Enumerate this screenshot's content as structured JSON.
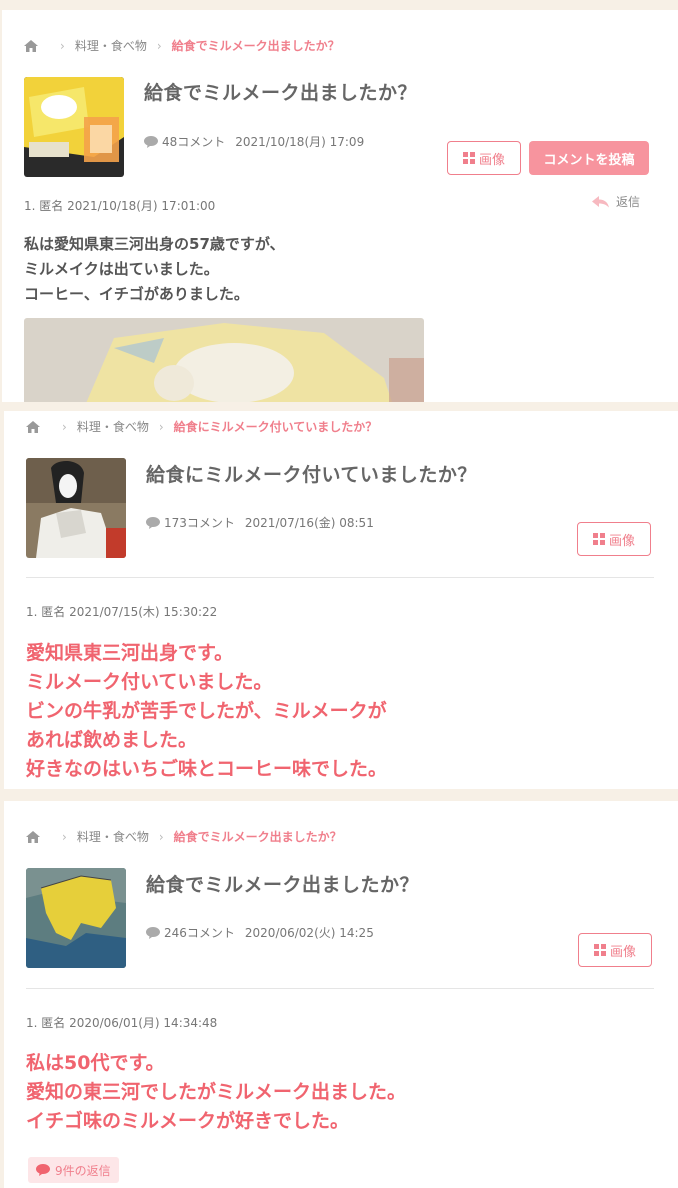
{
  "posts": [
    {
      "breadcrumb": {
        "category": "料理・食べ物",
        "current": "給食でミルメーク出ましたか？"
      },
      "title": "給食でミルメーク出ましたか？",
      "comment_count": "48コメント",
      "date": "2021/10/18(月) 17:09",
      "image_button": "画像",
      "post_button": "コメントを投稿",
      "comment_meta": "1. 匿名 2021/10/18(月) 17:01:00",
      "reply_label": "返信",
      "body": [
        "私は愛知県東三河出身の57歳ですが、",
        "ミルメイクは出ていました。",
        "コーヒー、イチゴがありました。"
      ]
    },
    {
      "breadcrumb": {
        "category": "料理・食べ物",
        "current": "給食にミルメーク付いていましたか？"
      },
      "title": "給食にミルメーク付いていましたか？",
      "comment_count": "173コメント",
      "date": "2021/07/16(金) 08:51",
      "image_button": "画像",
      "comment_meta": "1. 匿名 2021/07/15(木) 15:30:22",
      "body": [
        "愛知県東三河出身です。",
        "ミルメーク付いていました。",
        "ビンの牛乳が苦手でしたが、ミルメークが",
        "あれば飲めました。",
        "好きなのはいちご味とコーヒー味でした。"
      ]
    },
    {
      "breadcrumb": {
        "category": "料理・食べ物",
        "current": "給食でミルメーク出ましたか？"
      },
      "title": "給食でミルメーク出ましたか？",
      "comment_count": "246コメント",
      "date": "2020/06/02(火) 14:25",
      "image_button": "画像",
      "comment_meta": "1. 匿名 2020/06/01(月) 14:34:48",
      "body": [
        "私は50代です。",
        "愛知の東三河でしたがミルメーク出ました。",
        "イチゴ味のミルメークが好きでした。"
      ],
      "replies": "9件の返信"
    }
  ],
  "colors": {
    "accent": "#f07f8c",
    "accent_text": "#f0646f",
    "background": "#f7f0e6"
  },
  "icons": [
    "home-icon",
    "chevron-right-icon",
    "comment-bubble-icon",
    "grid-icon",
    "reply-arrow-icon"
  ]
}
